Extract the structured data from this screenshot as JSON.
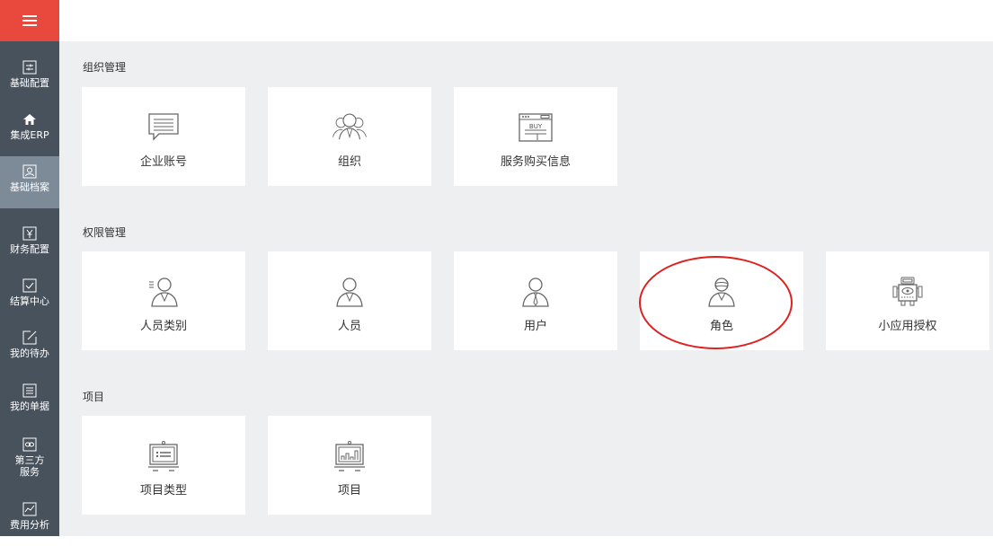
{
  "sidebar": {
    "menu_icon": "hamburger-icon",
    "items": [
      {
        "label": "基础配置",
        "icon": "sliders-icon"
      },
      {
        "label": "集成ERP",
        "icon": "home-icon"
      },
      {
        "label": "基础档案",
        "icon": "person-card-icon",
        "active": true
      },
      {
        "label": "财务配置",
        "icon": "yen-icon"
      },
      {
        "label": "结算中心",
        "icon": "checkbox-icon"
      },
      {
        "label": "我的待办",
        "icon": "edit-icon"
      },
      {
        "label": "我的单据",
        "icon": "list-icon"
      },
      {
        "label": "第三方服务",
        "icon": "link-icon"
      },
      {
        "label": "费用分析",
        "icon": "chart-icon"
      }
    ]
  },
  "sections": [
    {
      "title": "组织管理",
      "cards": [
        {
          "label": "企业账号",
          "icon": "message-board-icon"
        },
        {
          "label": "组织",
          "icon": "group-icon"
        },
        {
          "label": "服务购买信息",
          "icon": "buy-browser-icon"
        }
      ]
    },
    {
      "title": "权限管理",
      "cards": [
        {
          "label": "人员类别",
          "icon": "person-category-icon"
        },
        {
          "label": "人员",
          "icon": "person-icon"
        },
        {
          "label": "用户",
          "icon": "user-tie-icon"
        },
        {
          "label": "角色",
          "icon": "role-mask-icon",
          "highlighted": true
        },
        {
          "label": "小应用授权",
          "icon": "robot-icon"
        }
      ]
    },
    {
      "title": "项目",
      "cards": [
        {
          "label": "项目类型",
          "icon": "project-board-list-icon"
        },
        {
          "label": "项目",
          "icon": "project-board-chart-icon"
        }
      ]
    }
  ],
  "colors": {
    "sidebar_bg": "#47525d",
    "sidebar_active": "#7d8b98",
    "menu_button": "#e8493c",
    "content_bg": "#eeeff1",
    "highlight_ring": "#e02020"
  }
}
